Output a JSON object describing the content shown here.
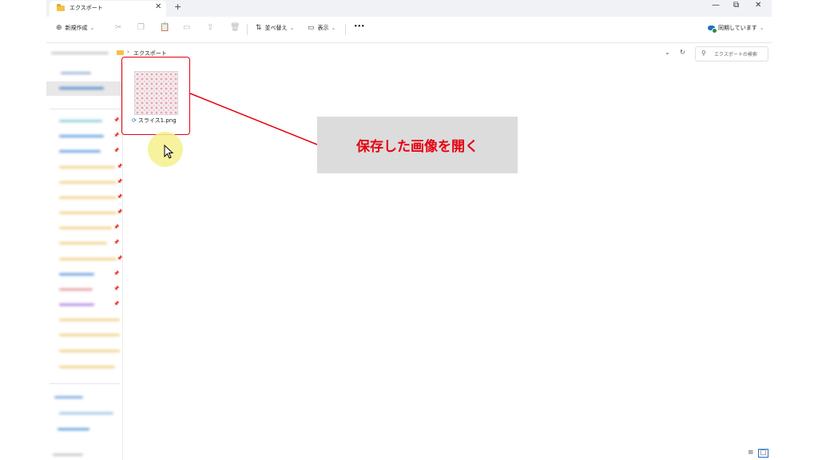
{
  "window": {
    "tab_title": "エクスポート",
    "tab_close": "✕",
    "tab_add": "+",
    "minimize": "—",
    "restore": "⧉",
    "close": "✕"
  },
  "toolbar": {
    "new_label": "新規作成",
    "new_icon": "⊕",
    "sort_label": "並べ替え",
    "view_label": "表示",
    "more": "•••",
    "sync_status": "同期しています",
    "dropdown": "⌄"
  },
  "address": {
    "current_folder": "エクスポート",
    "separator": "›",
    "search_placeholder": "エクスポートの検索",
    "chevron": "⌄",
    "refresh": "↻"
  },
  "files": [
    {
      "name": "スライス1.png",
      "sync_icon": "⟳"
    }
  ],
  "callout": {
    "text": "保存した画像を開く"
  },
  "colors": {
    "highlight_red": "#e60012",
    "callout_bg": "#dcdcdc",
    "folder_yellow": "#f3c14a",
    "onedrive_blue": "#1e6fc9"
  }
}
